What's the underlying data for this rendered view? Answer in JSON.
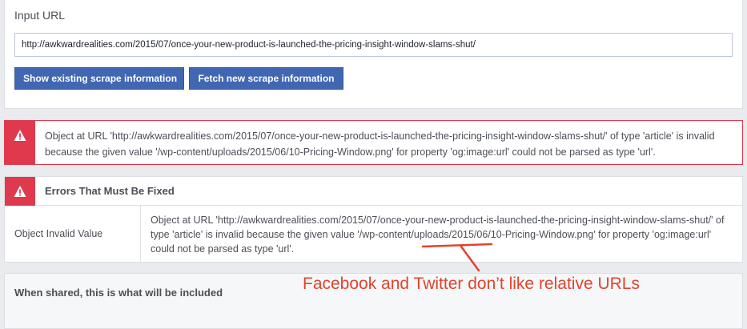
{
  "input_panel": {
    "label": "Input URL",
    "url_value": "http://awkwardrealities.com/2015/07/once-your-new-product-is-launched-the-pricing-insight-window-slams-shut/",
    "buttons": {
      "show_existing": "Show existing scrape information",
      "fetch_new": "Fetch new scrape information"
    }
  },
  "error_banner": {
    "icon": "warning-icon",
    "message": "Object at URL 'http://awkwardrealities.com/2015/07/once-your-new-product-is-launched-the-pricing-insight-window-slams-shut/' of type 'article' is invalid because the given value '/wp-content/uploads/2015/06/10-Pricing-Window.png' for property 'og:image:url' could not be parsed as type 'url'."
  },
  "errors_panel": {
    "icon": "warning-icon",
    "title": "Errors That Must Be Fixed",
    "rows": [
      {
        "key": "Object Invalid Value",
        "value": "Object at URL 'http://awkwardrealities.com/2015/07/once-your-new-product-is-launched-the-pricing-insight-window-slams-shut/' of type 'article' is invalid because the given value '/wp-content/uploads/2015/06/10-Pricing-Window.png' for property 'og:image:url' could not be parsed as type 'url'."
      }
    ]
  },
  "shared_panel": {
    "title": "When shared, this is what will be included"
  },
  "annotation": {
    "text": "Facebook and Twitter don’t like relative URLs",
    "color": "#e0442c"
  },
  "colors": {
    "error_red": "#e0394d",
    "button_blue": "#4267b2",
    "page_bg": "#e9ebee"
  }
}
